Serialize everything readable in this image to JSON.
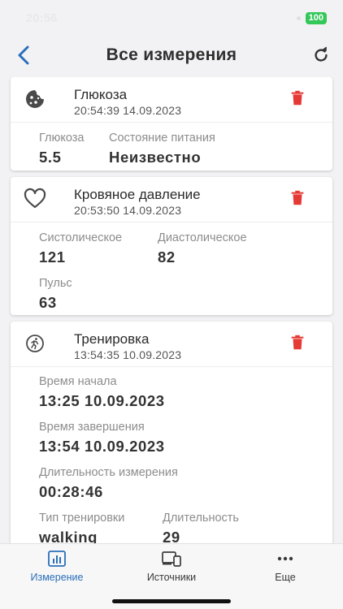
{
  "status": {
    "time": "20:56",
    "battery": "100"
  },
  "header": {
    "title": "Все измерения"
  },
  "cards": [
    {
      "title": "Глюкоза",
      "time": "20:54:39 14.09.2023",
      "fields": [
        {
          "label": "Глюкоза",
          "value": "5.5"
        },
        {
          "label": "Состояние питания",
          "value": "Неизвестно"
        }
      ]
    },
    {
      "title": "Кровяное давление",
      "time": "20:53:50 14.09.2023",
      "fields": [
        {
          "label": "Систолическое",
          "value": "121"
        },
        {
          "label": "Диастолическое",
          "value": "82"
        },
        {
          "label": "Пульс",
          "value": "63"
        }
      ]
    },
    {
      "title": "Тренировка",
      "time": "13:54:35 10.09.2023",
      "fields": [
        {
          "label": "Время начала",
          "value": "13:25 10.09.2023"
        },
        {
          "label": "Время завершения",
          "value": "13:54 10.09.2023"
        },
        {
          "label": "Длительность измерения",
          "value": "00:28:46"
        },
        {
          "label": "Тип тренировки",
          "value": "walking"
        },
        {
          "label": "Длительность",
          "value": "29"
        }
      ]
    }
  ],
  "tabs": [
    {
      "label": "Измерение",
      "icon": "chart-icon",
      "active": true
    },
    {
      "label": "Источники",
      "icon": "devices-icon",
      "active": false
    },
    {
      "label": "Еще",
      "icon": "more-icon",
      "active": false
    }
  ],
  "colors": {
    "accent": "#2a6fba",
    "delete": "#e53935",
    "background": "#f2f2f4"
  }
}
